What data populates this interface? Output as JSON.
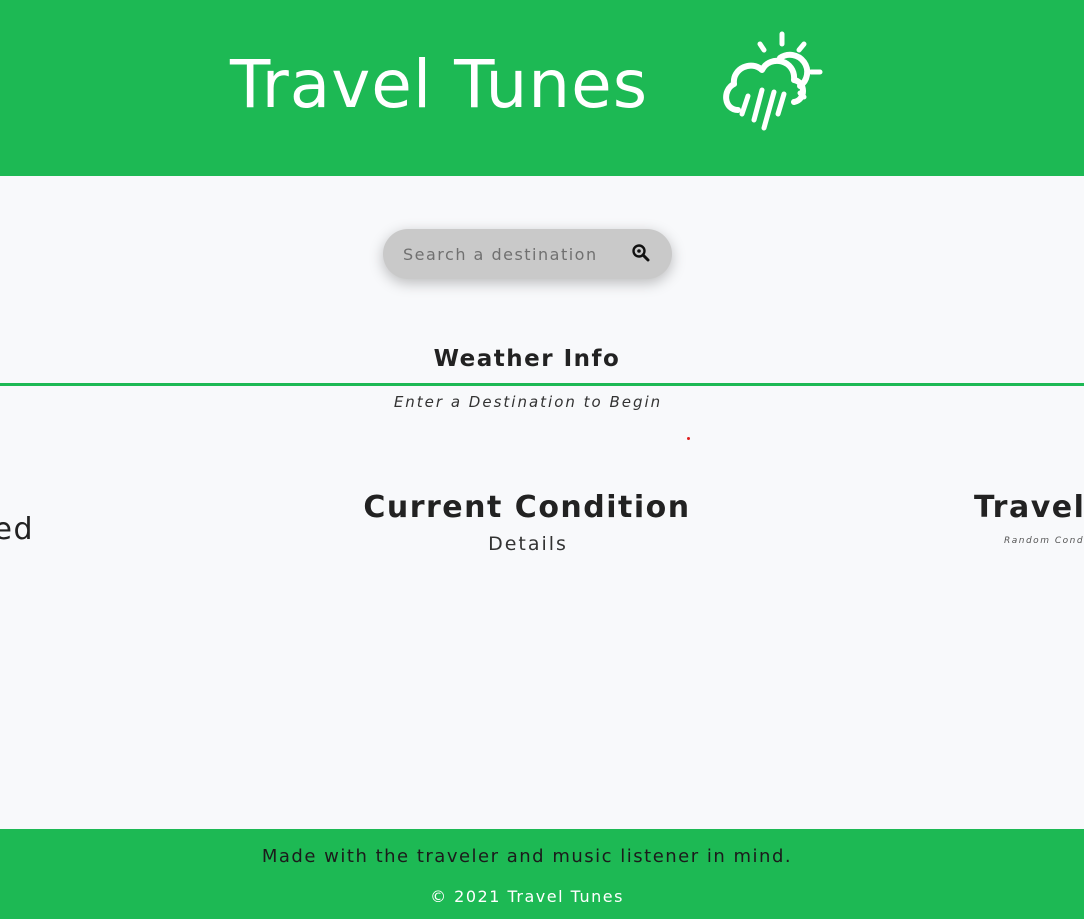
{
  "header": {
    "title": "Travel Tunes",
    "icon": "weather-cloud-sun-rain-icon",
    "background_color": "#1db954"
  },
  "search": {
    "placeholder": "Search a destination",
    "value": "",
    "button_icon": "search-magnifier-icon"
  },
  "weather": {
    "title": "Weather Info",
    "subtitle": "Enter a Destination to Begin",
    "accent_color": "#1db954"
  },
  "columns": {
    "left_title_partial": "ed",
    "center_title": "Current Condition",
    "center_subtitle": "Details",
    "right_title_partial": "Travel",
    "right_subtitle_partial": "Random Cond"
  },
  "footer": {
    "tagline": "Made with the traveler and music listener in mind.",
    "copyright": "© 2021 Travel Tunes"
  }
}
